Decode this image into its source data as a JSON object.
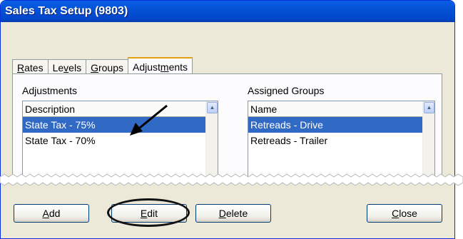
{
  "window": {
    "title": "Sales Tax Setup (9803)"
  },
  "tabs": [
    {
      "pre": "",
      "ul": "R",
      "post": "ates"
    },
    {
      "pre": "Le",
      "ul": "v",
      "post": "els"
    },
    {
      "pre": "",
      "ul": "G",
      "post": "roups"
    },
    {
      "pre": "Adjust",
      "ul": "m",
      "post": "ents"
    }
  ],
  "active_tab": "Adjustments",
  "adjustments": {
    "label": "Adjustments",
    "column": "Description",
    "rows": [
      "State Tax - 75%",
      "State Tax - 70%"
    ],
    "selected_index": 0
  },
  "assigned_groups": {
    "label": "Assigned Groups",
    "column": "Name",
    "rows": [
      "Retreads - Drive",
      "Retreads - Trailer"
    ],
    "selected_index": 0
  },
  "buttons": {
    "add": {
      "pre": "",
      "ul": "A",
      "post": "dd"
    },
    "edit": {
      "pre": "",
      "ul": "E",
      "post": "dit"
    },
    "delete": {
      "pre": "",
      "ul": "D",
      "post": "elete"
    },
    "close": {
      "pre": "",
      "ul": "C",
      "post": "lose"
    }
  },
  "colors": {
    "title_bar": "#0054e3",
    "selection": "#316ac5",
    "dialog_bg": "#ece9d8"
  },
  "icons": [
    "scroll-up-arrow-icon",
    "callout-arrow-icon",
    "highlight-ellipse-icon"
  ]
}
